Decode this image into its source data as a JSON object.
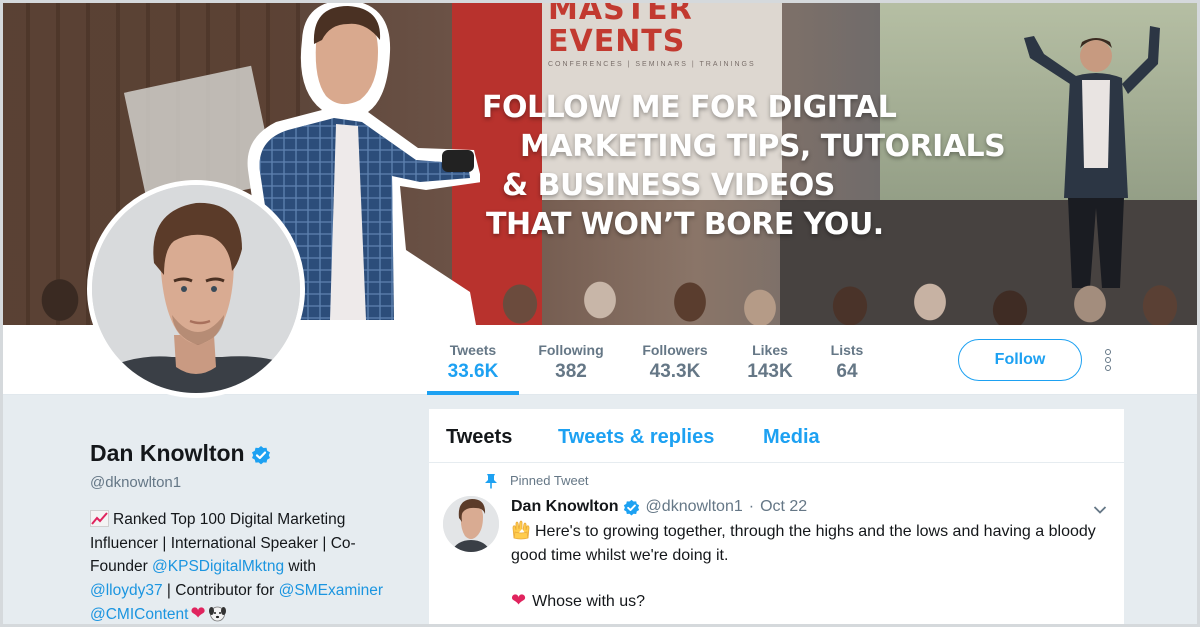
{
  "banner": {
    "event_logo_name": "MASTER EVENTS",
    "event_logo_sub": "CONFERENCES | SEMINARS | TRAININGS",
    "tagline": [
      "FOLLOW ME FOR DIGITAL",
      "MARKETING TIPS, TUTORIALS",
      "& BUSINESS VIDEOS",
      "THAT WON’T BORE YOU."
    ]
  },
  "stats": [
    {
      "label": "Tweets",
      "value": "33.6K",
      "active": true
    },
    {
      "label": "Following",
      "value": "382",
      "active": false
    },
    {
      "label": "Followers",
      "value": "43.3K",
      "active": false
    },
    {
      "label": "Likes",
      "value": "143K",
      "active": false
    },
    {
      "label": "Lists",
      "value": "64",
      "active": false
    }
  ],
  "follow_label": "Follow",
  "profile": {
    "name": "Dan Knowlton",
    "handle": "@dknowlton1",
    "bio": {
      "part1": "Ranked Top 100 Digital Marketing Influencer | International Speaker | Co-Founder ",
      "link1": "@KPSDigitalMktng",
      "part2": " with ",
      "link2": "@lloydy37",
      "part3": " | Contributor for ",
      "link3": "@SMExaminer",
      "part4": " ",
      "link4": "@CMIContent"
    }
  },
  "tabs": [
    {
      "label": "Tweets",
      "active": true
    },
    {
      "label": "Tweets & replies",
      "active": false
    },
    {
      "label": "Media",
      "active": false
    }
  ],
  "tweet": {
    "pinned_label": "Pinned Tweet",
    "name": "Dan Knowlton",
    "handle": "@dknowlton1",
    "separator": "·",
    "date": "Oct 22",
    "text": "Here's to growing together, through the highs and the lows and having a bloody good time whilst we're doing it.",
    "text2": "Whose with us?"
  },
  "colors": {
    "accent": "#1da1f2",
    "link": "#1b95e0",
    "muted": "#657786",
    "heart": "#e0245e",
    "background": "#e6ecf0"
  },
  "icons": [
    "verified-badge-icon",
    "pin-icon",
    "chevron-down-icon",
    "more-vertical-icon",
    "chart-increasing-emoji-icon",
    "heart-emoji-icon",
    "dog-emoji-icon",
    "raising-hands-emoji-icon"
  ]
}
